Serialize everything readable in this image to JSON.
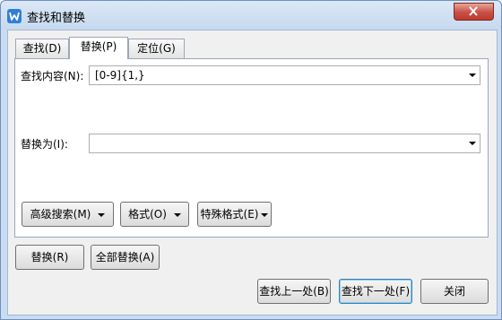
{
  "window": {
    "title": "查找和替换"
  },
  "tabs": [
    {
      "label": "查找(D)",
      "active": false
    },
    {
      "label": "替换(P)",
      "active": true
    },
    {
      "label": "定位(G)",
      "active": false
    }
  ],
  "find": {
    "label": "查找内容(N):",
    "value": "[0-9]{1,}"
  },
  "replace": {
    "label": "替换为(I):",
    "value": ""
  },
  "options": {
    "advanced_label": "高级搜索(M)",
    "format_label": "格式(O)",
    "special_label": "特殊格式(E)"
  },
  "actions": {
    "replace_label": "替换(R)",
    "replace_all_label": "全部替换(A)",
    "find_prev_label": "查找上一处(B)",
    "find_next_label": "查找下一处(F)",
    "close_label": "关闭"
  },
  "colors": {
    "title_bar": "#c6d9ef",
    "close_button": "#c75047",
    "default_button_border": "#3c7fb1"
  },
  "icons": {
    "app": "wps-writer-icon",
    "close": "close-icon"
  }
}
